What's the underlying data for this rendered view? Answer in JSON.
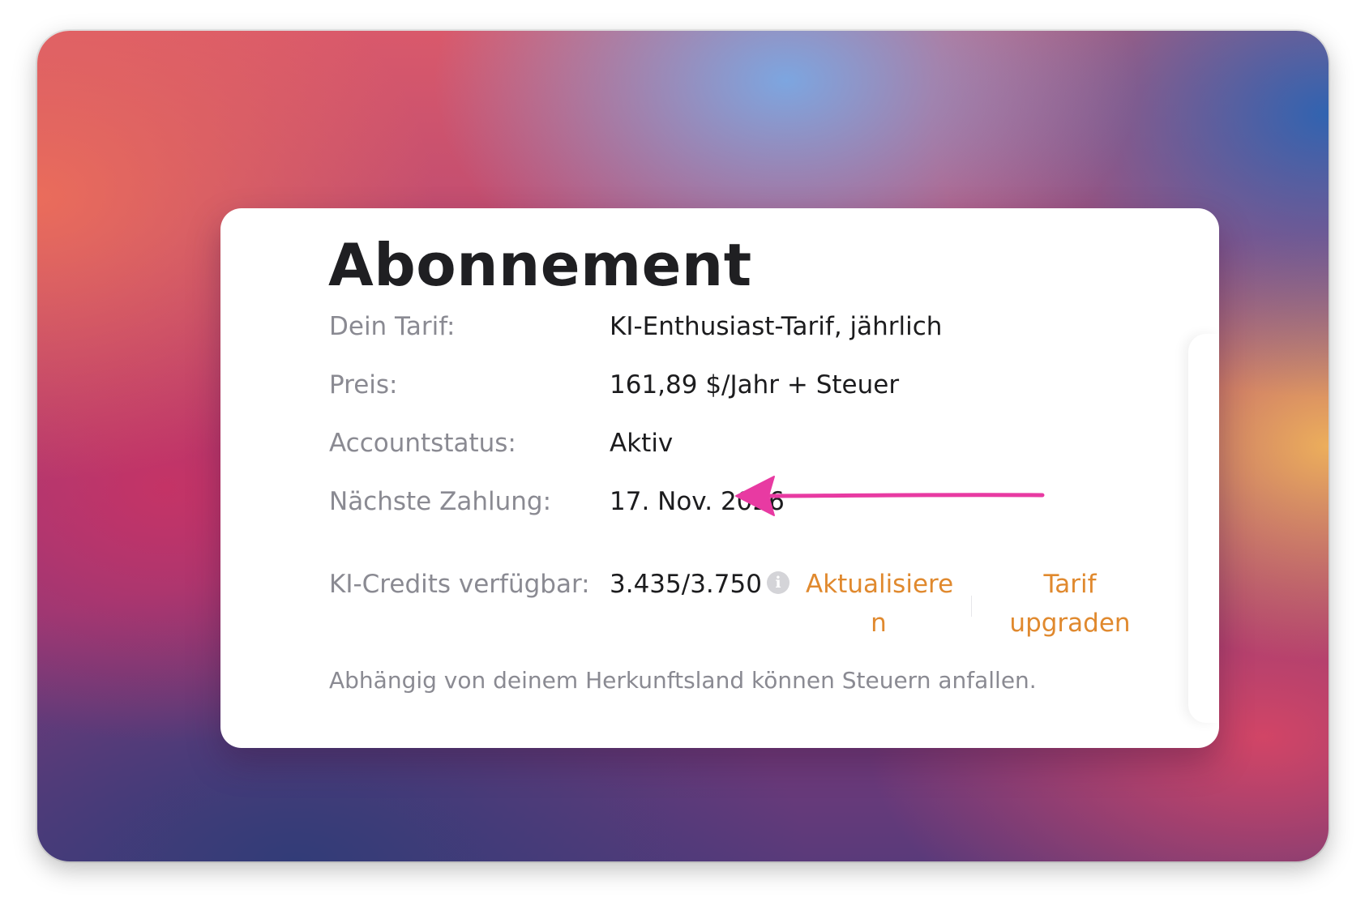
{
  "subscription": {
    "title": "Abonnement",
    "rows": [
      {
        "label": "Dein Tarif:",
        "value": "KI-Enthusiast-Tarif, jährlich"
      },
      {
        "label": "Preis:",
        "value": "161,89 $/Jahr + Steuer"
      },
      {
        "label": "Accountstatus:",
        "value": "Aktiv"
      },
      {
        "label": "Nächste Zahlung:",
        "value": "17. Nov. 2026"
      },
      {
        "label": "KI-Credits verfügbar:",
        "value": "3.435/3.750"
      }
    ],
    "info_icon_glyph": "i",
    "actions": {
      "refresh_line1": "Aktualisiere",
      "refresh_line2": "n",
      "upgrade_line1": "Tarif",
      "upgrade_line2": "upgraden"
    },
    "footnote": "Abhängig von deinem Herkunftsland können Steuern anfallen."
  },
  "colors": {
    "link": "#e0892e",
    "annotation_arrow": "#e83aa2"
  },
  "icons": {
    "info": "info-icon",
    "annotation": "arrow-left-icon"
  }
}
